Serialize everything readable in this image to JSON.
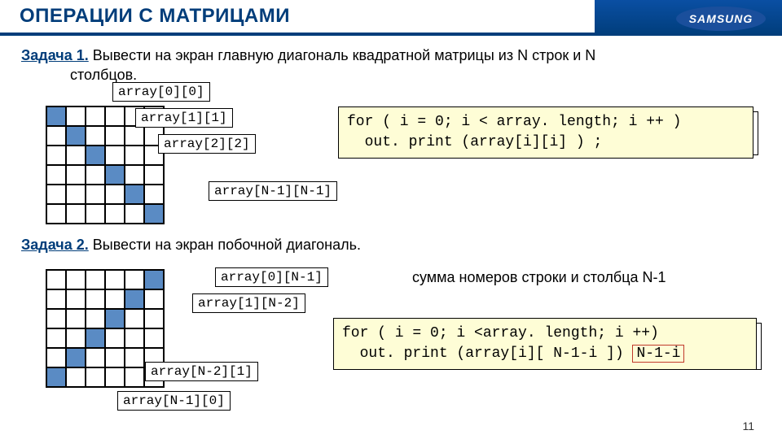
{
  "header": {
    "title": "ОПЕРАЦИИ С МАТРИЦАМИ",
    "brand": "SAMSUNG"
  },
  "task1": {
    "label": "Задача 1.",
    "line1": " Вывести на экран главную диагональ квадратной матрицы из N строк и N",
    "line2": "столбцов."
  },
  "labels1": {
    "a00": "array[0][0]",
    "a11": "array[1][1]",
    "a22": "array[2][2]",
    "aNN": "array[N-1][N-1]"
  },
  "code1": {
    "l1": "for ( i = 0; i < array. length; i ++ )",
    "l2": "  out. print (array[i][i] ) ;"
  },
  "task2": {
    "label": "Задача 2.",
    "text": " Вывести на экран побочной диагональ."
  },
  "labels2": {
    "a0n1": "array[0][N-1]",
    "a1n2": "array[1][N-2]",
    "an21": "array[N-2][1]",
    "an10": "array[N-1][0]"
  },
  "info2": "сумма номеров строки и столбца N-1",
  "code2": {
    "l1": "for ( i = 0; i <array. length; i ++)",
    "l2p1": "  out. print (array[i][ N-1-i ]) ",
    "hl": "N-1-i"
  },
  "page": "11"
}
